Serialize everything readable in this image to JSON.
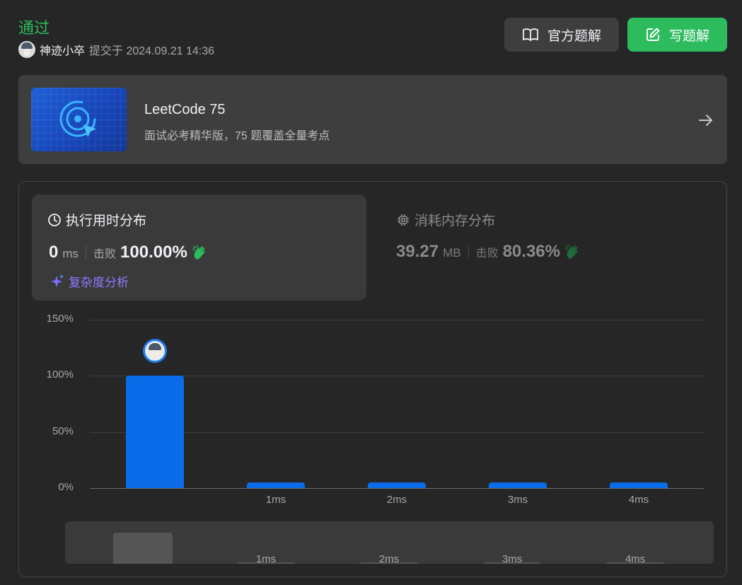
{
  "header": {
    "status": "通过",
    "author_name": "神迹小卒",
    "submit_time": "提交于 2024.09.21 14:36",
    "official_solution_label": "官方题解",
    "write_solution_label": "写题解"
  },
  "banner": {
    "title": "LeetCode 75",
    "subtitle": "面试必考精华版，75 题覆盖全量考点",
    "arrow_icon": "arrow-right-icon"
  },
  "runtime": {
    "title": "执行用时分布",
    "value": "0",
    "unit": "ms",
    "beat_label": "击败",
    "beat_value": "100.00%",
    "analysis_label": "复杂度分析"
  },
  "memory": {
    "title": "消耗内存分布",
    "value": "39.27",
    "unit": "MB",
    "beat_label": "击败",
    "beat_value": "80.36%"
  },
  "colors": {
    "accent_green": "#2cbb5d",
    "bar_blue": "#0a6ce8",
    "analysis_purple": "#8e7bff"
  },
  "chart_data": {
    "type": "bar",
    "categories": [
      "",
      "1ms",
      "2ms",
      "3ms",
      "4ms"
    ],
    "values": [
      100,
      5,
      5,
      5,
      5
    ],
    "ylim": [
      0,
      150
    ],
    "yticks": [
      "0%",
      "50%",
      "100%",
      "150%"
    ],
    "grid": true,
    "highlight_index": 0
  },
  "overview": {
    "labels": [
      "1ms",
      "2ms",
      "3ms",
      "4ms"
    ]
  }
}
